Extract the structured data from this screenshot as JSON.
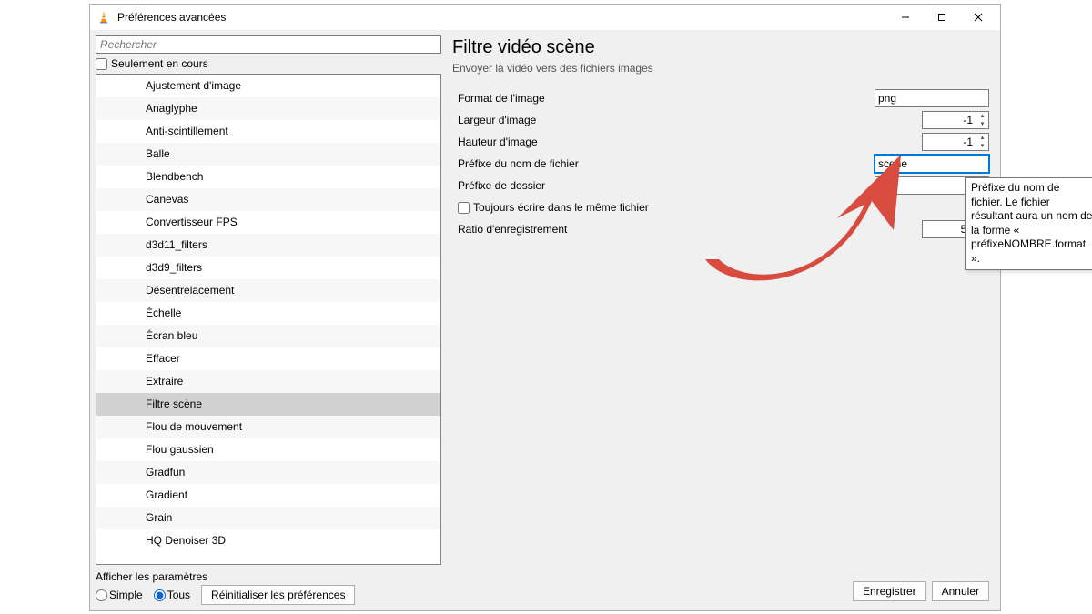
{
  "titlebar": {
    "title": "Préférences avancées"
  },
  "search": {
    "placeholder": "Rechercher"
  },
  "onlyCurrent": {
    "label": "Seulement en cours"
  },
  "tree": {
    "items": [
      "Ajustement d'image",
      "Anaglyphe",
      "Anti-scintillement",
      "Balle",
      "Blendbench",
      "Canevas",
      "Convertisseur FPS",
      "d3d11_filters",
      "d3d9_filters",
      "Désentrelacement",
      "Échelle",
      "Écran bleu",
      "Effacer",
      "Extraire",
      "Filtre scène",
      "Flou de mouvement",
      "Flou gaussien",
      "Gradfun",
      "Gradient",
      "Grain",
      "HQ Denoiser 3D"
    ],
    "selected": 14
  },
  "panel": {
    "title": "Filtre vidéo scène",
    "subtitle": "Envoyer la vidéo vers des fichiers images",
    "fields": {
      "format": {
        "label": "Format de l'image",
        "value": "png"
      },
      "width": {
        "label": "Largeur d'image",
        "value": "-1"
      },
      "height": {
        "label": "Hauteur d'image",
        "value": "-1"
      },
      "prefix": {
        "label": "Préfixe du nom de fichier",
        "value": "scene"
      },
      "dirprefix": {
        "label": "Préfixe de dossier",
        "value": ""
      },
      "always": {
        "label": "Toujours écrire dans le même fichier"
      },
      "ratio": {
        "label": "Ratio d'enregistrement",
        "value": "50"
      }
    }
  },
  "tooltip": {
    "text": "Préfixe du nom de fichier. Le fichier résultant aura un nom de la forme « préfixeNOMBRE.format »."
  },
  "showOpts": {
    "title": "Afficher les paramètres",
    "simple": "Simple",
    "all": "Tous",
    "reset": "Réinitialiser les préférences"
  },
  "buttons": {
    "save": "Enregistrer",
    "cancel": "Annuler"
  }
}
